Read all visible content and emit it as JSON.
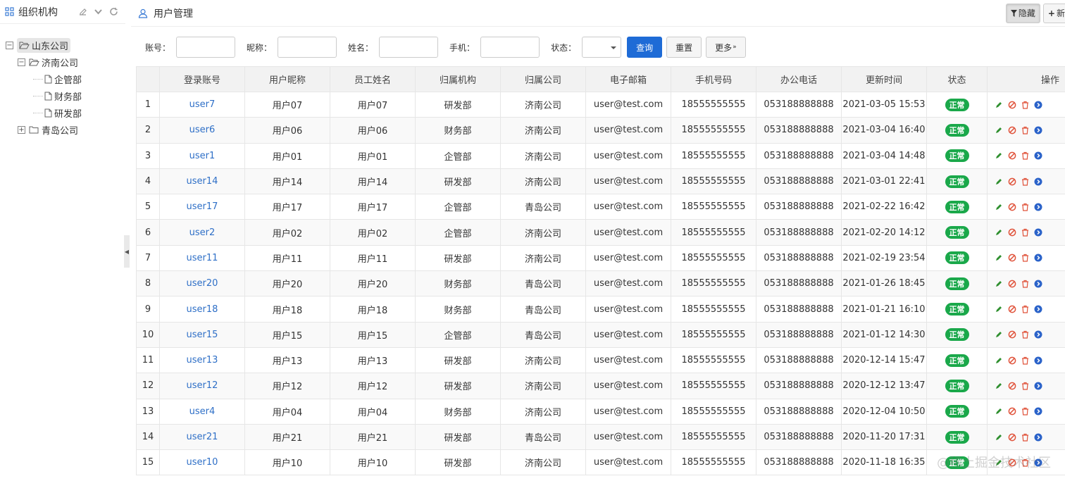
{
  "left": {
    "title": "组织机构",
    "tree": [
      {
        "label": "山东公司",
        "level": 0,
        "expanded": true,
        "selected": true,
        "type": "folder"
      },
      {
        "label": "济南公司",
        "level": 1,
        "expanded": true,
        "type": "folder"
      },
      {
        "label": "企管部",
        "level": 2,
        "type": "file"
      },
      {
        "label": "财务部",
        "level": 2,
        "type": "file"
      },
      {
        "label": "研发部",
        "level": 2,
        "type": "file"
      },
      {
        "label": "青岛公司",
        "level": 1,
        "expanded": false,
        "type": "folder"
      }
    ]
  },
  "main": {
    "title": "用户管理",
    "hide_label": "隐藏",
    "new_label": "新"
  },
  "search": {
    "account_label": "账号：",
    "nickname_label": "昵称：",
    "name_label": "姓名：",
    "phone_label": "手机：",
    "status_label": "状态：",
    "query": "查询",
    "reset": "重置",
    "more": "更多"
  },
  "table": {
    "columns": [
      "",
      "登录账号",
      "用户昵称",
      "员工姓名",
      "归属机构",
      "归属公司",
      "电子邮箱",
      "手机号码",
      "办公电话",
      "更新时间",
      "状态",
      "操作"
    ],
    "rows": [
      [
        "1",
        "user7",
        "用户07",
        "用户07",
        "研发部",
        "济南公司",
        "user@test.com",
        "18555555555",
        "053188888888",
        "2021-03-05 15:53",
        "正常"
      ],
      [
        "2",
        "user6",
        "用户06",
        "用户06",
        "财务部",
        "济南公司",
        "user@test.com",
        "18555555555",
        "053188888888",
        "2021-03-04 16:40",
        "正常"
      ],
      [
        "3",
        "user1",
        "用户01",
        "用户01",
        "企管部",
        "济南公司",
        "user@test.com",
        "18555555555",
        "053188888888",
        "2021-03-04 14:48",
        "正常"
      ],
      [
        "4",
        "user14",
        "用户14",
        "用户14",
        "研发部",
        "济南公司",
        "user@test.com",
        "18555555555",
        "053188888888",
        "2021-03-01 22:41",
        "正常"
      ],
      [
        "5",
        "user17",
        "用户17",
        "用户17",
        "企管部",
        "青岛公司",
        "user@test.com",
        "18555555555",
        "053188888888",
        "2021-02-22 16:42",
        "正常"
      ],
      [
        "6",
        "user2",
        "用户02",
        "用户02",
        "企管部",
        "济南公司",
        "user@test.com",
        "18555555555",
        "053188888888",
        "2021-02-20 14:12",
        "正常"
      ],
      [
        "7",
        "user11",
        "用户11",
        "用户11",
        "研发部",
        "济南公司",
        "user@test.com",
        "18555555555",
        "053188888888",
        "2021-02-19 23:54",
        "正常"
      ],
      [
        "8",
        "user20",
        "用户20",
        "用户20",
        "财务部",
        "青岛公司",
        "user@test.com",
        "18555555555",
        "053188888888",
        "2021-01-26 18:45",
        "正常"
      ],
      [
        "9",
        "user18",
        "用户18",
        "用户18",
        "财务部",
        "青岛公司",
        "user@test.com",
        "18555555555",
        "053188888888",
        "2021-01-21 16:10",
        "正常"
      ],
      [
        "10",
        "user15",
        "用户15",
        "用户15",
        "企管部",
        "青岛公司",
        "user@test.com",
        "18555555555",
        "053188888888",
        "2021-01-12 14:30",
        "正常"
      ],
      [
        "11",
        "user13",
        "用户13",
        "用户13",
        "研发部",
        "济南公司",
        "user@test.com",
        "18555555555",
        "053188888888",
        "2020-12-14 15:47",
        "正常"
      ],
      [
        "12",
        "user12",
        "用户12",
        "用户12",
        "研发部",
        "济南公司",
        "user@test.com",
        "18555555555",
        "053188888888",
        "2020-12-12 13:47",
        "正常"
      ],
      [
        "13",
        "user4",
        "用户04",
        "用户04",
        "财务部",
        "济南公司",
        "user@test.com",
        "18555555555",
        "053188888888",
        "2020-12-04 10:50",
        "正常"
      ],
      [
        "14",
        "user21",
        "用户21",
        "用户21",
        "研发部",
        "青岛公司",
        "user@test.com",
        "18555555555",
        "053188888888",
        "2020-11-20 17:31",
        "正常"
      ],
      [
        "15",
        "user10",
        "用户10",
        "用户10",
        "研发部",
        "济南公司",
        "user@test.com",
        "18555555555",
        "053188888888",
        "2020-11-18 16:35",
        "正常"
      ]
    ]
  },
  "watermark": "@稀土掘金技术社区",
  "colors": {
    "primary": "#1e6bd6",
    "link": "#2e6fc7",
    "status_ok": "#1aa84a",
    "delete": "#e0533b",
    "disable": "#e0533b",
    "edit": "#2f8f2f",
    "detail": "#2a62c9"
  }
}
